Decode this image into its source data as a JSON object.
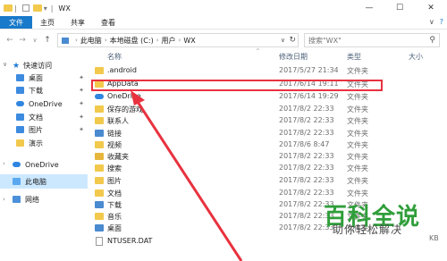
{
  "window": {
    "title": "WX",
    "minimize": "—",
    "maximize": "☐",
    "close": "✕"
  },
  "ribbon": {
    "tabs": [
      "文件",
      "主页",
      "共享",
      "查看"
    ],
    "collapse": "∨",
    "help": "?"
  },
  "address": {
    "crumbs": [
      "此电脑",
      "本地磁盘 (C:)",
      "用户",
      "WX"
    ],
    "dropdown": "∨",
    "refresh": "↻"
  },
  "search": {
    "placeholder": "搜索\"WX\""
  },
  "nav": {
    "quick_access": "快速访问",
    "items": [
      "桌面",
      "下载",
      "OneDrive",
      "文档",
      "图片",
      "演示"
    ],
    "onedrive": "OneDrive",
    "this_pc": "此电脑",
    "network": "网络"
  },
  "columns": {
    "name": "名称",
    "date": "修改日期",
    "type": "类型",
    "size": "大小"
  },
  "files": [
    {
      "name": ".android",
      "date": "2017/5/27 21:34",
      "type": "文件夹",
      "size": "",
      "icon": "folder"
    },
    {
      "name": "AppData",
      "date": "2017/6/14 19:11",
      "type": "文件夹",
      "size": "",
      "icon": "folder"
    },
    {
      "name": "OneDrive",
      "date": "2017/6/14 19:29",
      "type": "文件夹",
      "size": "",
      "icon": "cloud"
    },
    {
      "name": "保存的游戏",
      "date": "2017/8/2 22:33",
      "type": "文件夹",
      "size": "",
      "icon": "folder"
    },
    {
      "name": "联系人",
      "date": "2017/8/2 22:33",
      "type": "文件夹",
      "size": "",
      "icon": "folder"
    },
    {
      "name": "链接",
      "date": "2017/8/2 22:33",
      "type": "文件夹",
      "size": "",
      "icon": "blue"
    },
    {
      "name": "视频",
      "date": "2017/8/6 8:47",
      "type": "文件夹",
      "size": "",
      "icon": "folder"
    },
    {
      "name": "收藏夹",
      "date": "2017/8/2 22:33",
      "type": "文件夹",
      "size": "",
      "icon": "star"
    },
    {
      "name": "搜索",
      "date": "2017/8/2 22:33",
      "type": "文件夹",
      "size": "",
      "icon": "folder"
    },
    {
      "name": "图片",
      "date": "2017/8/2 22:33",
      "type": "文件夹",
      "size": "",
      "icon": "folder"
    },
    {
      "name": "文档",
      "date": "2017/8/2 22:33",
      "type": "文件夹",
      "size": "",
      "icon": "folder"
    },
    {
      "name": "下载",
      "date": "2017/8/2 22:33",
      "type": "文件夹",
      "size": "",
      "icon": "blue"
    },
    {
      "name": "音乐",
      "date": "2017/8/2 22:33",
      "type": "文件夹",
      "size": "",
      "icon": "folder"
    },
    {
      "name": "桌面",
      "date": "2017/8/2 22:33",
      "type": "文件夹",
      "size": "",
      "icon": "blue"
    },
    {
      "name": "NTUSER.DAT",
      "date": "",
      "type": "",
      "size": "",
      "icon": "doc"
    }
  ],
  "status_size": "KB",
  "watermark": {
    "title": "百科全说",
    "subtitle": "助你轻松解决"
  },
  "colors": {
    "accent": "#1979ca",
    "highlight": "#e8323f",
    "watermark": "#2f9e3a"
  }
}
